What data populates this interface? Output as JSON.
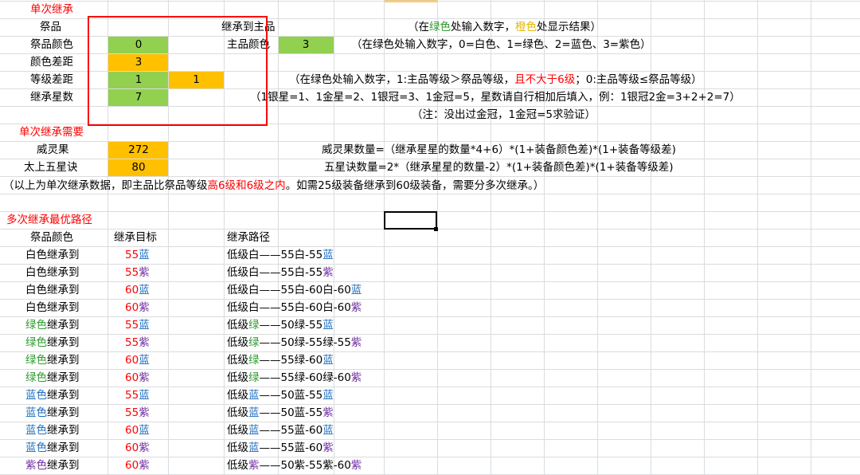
{
  "colors": {
    "green_cell": "#92d050",
    "orange_cell": "#ffc000",
    "red_text": "#ff0000",
    "blue_text": "#1f6fbf",
    "purple_text": "#7030a0",
    "green_text": "#2e9b2e",
    "yellow_text": "#e6b800",
    "grid": "#dadcdd"
  },
  "single": {
    "title": "单次继承",
    "sacrifice": "祭品",
    "inherit_to": "继承到主品",
    "note1": {
      "a": "（在",
      "b": "绿色",
      "c": "处输入数字，",
      "d": "橙色",
      "e": "处显示结果）"
    },
    "sac_color_label": "祭品颜色",
    "sac_color_value": "0",
    "main_color_label": "主品颜色",
    "main_color_value": "3",
    "note2": "（在绿色处输入数字，0=白色、1=绿色、2=蓝色、3=紫色）",
    "color_diff_label": "颜色差距",
    "color_diff_value": "3",
    "level_diff_label": "等级差距",
    "level_diff_value": "1",
    "level_diff_result": "1",
    "note3": {
      "a": "（在绿色处输入数字，1:主品等级＞祭品等级，",
      "b": "且不大于6级",
      "c": "；0:主品等级≤祭品等级）"
    },
    "stars_label": "继承星数",
    "stars_value": "7",
    "note4": "（1银星=1、1金星=2、1银冠=3、1金冠=5，星数请自行相加后填入，例：1银冠2金=3+2+2=7）",
    "note5": "（注：没出过金冠，1金冠=5求验证）"
  },
  "need": {
    "title": "单次继承需要",
    "fruit_label": "威灵果",
    "fruit_value": "272",
    "fruit_formula": "威灵果数量=（继承星星的数量*4+6）*(1+装备颜色差)*(1+装备等级差)",
    "tactic_label": "太上五星诀",
    "tactic_value": "80",
    "tactic_formula": "五星诀数量=2*（继承星星的数量-2）*(1+装备颜色差)*(1+装备等级差)",
    "summary": {
      "a": "（以上为单次继承数据，即主品比祭品等级",
      "b": "高6级和6级之内",
      "c": "。如需25级装备继承到60级装备，需要分多次继承。）"
    }
  },
  "multi": {
    "title": "多次继承最优路径",
    "col_color": "祭品颜色",
    "col_target": "继承目标",
    "col_path": "继承路径",
    "rows": [
      {
        "src": [
          [
            "白色",
            "k"
          ],
          [
            "继承到",
            "k"
          ]
        ],
        "tgt": [
          [
            "55",
            "r"
          ],
          [
            "蓝",
            "b"
          ]
        ],
        "path": [
          [
            "低级白——55白-55",
            "k"
          ],
          [
            "蓝",
            "b"
          ]
        ]
      },
      {
        "src": [
          [
            "白色",
            "k"
          ],
          [
            "继承到",
            "k"
          ]
        ],
        "tgt": [
          [
            "55",
            "r"
          ],
          [
            "紫",
            "p"
          ]
        ],
        "path": [
          [
            "低级白——55白-55",
            "k"
          ],
          [
            "紫",
            "p"
          ]
        ]
      },
      {
        "src": [
          [
            "白色",
            "k"
          ],
          [
            "继承到",
            "k"
          ]
        ],
        "tgt": [
          [
            "60",
            "r"
          ],
          [
            "蓝",
            "b"
          ]
        ],
        "path": [
          [
            "低级白——55白-60白-60",
            "k"
          ],
          [
            "蓝",
            "b"
          ]
        ]
      },
      {
        "src": [
          [
            "白色",
            "k"
          ],
          [
            "继承到",
            "k"
          ]
        ],
        "tgt": [
          [
            "60",
            "r"
          ],
          [
            "紫",
            "p"
          ]
        ],
        "path": [
          [
            "低级白——55白-60白-60",
            "k"
          ],
          [
            "紫",
            "p"
          ]
        ]
      },
      {
        "src": [
          [
            "绿色",
            "g"
          ],
          [
            "继承到",
            "k"
          ]
        ],
        "tgt": [
          [
            "55",
            "r"
          ],
          [
            "蓝",
            "b"
          ]
        ],
        "path": [
          [
            "低级",
            "k"
          ],
          [
            "绿",
            "g"
          ],
          [
            "——50绿-55",
            "k"
          ],
          [
            "蓝",
            "b"
          ]
        ]
      },
      {
        "src": [
          [
            "绿色",
            "g"
          ],
          [
            "继承到",
            "k"
          ]
        ],
        "tgt": [
          [
            "55",
            "r"
          ],
          [
            "紫",
            "p"
          ]
        ],
        "path": [
          [
            "低级",
            "k"
          ],
          [
            "绿",
            "g"
          ],
          [
            "——50绿-55绿-55",
            "k"
          ],
          [
            "紫",
            "p"
          ]
        ]
      },
      {
        "src": [
          [
            "绿色",
            "g"
          ],
          [
            "继承到",
            "k"
          ]
        ],
        "tgt": [
          [
            "60",
            "r"
          ],
          [
            "蓝",
            "b"
          ]
        ],
        "path": [
          [
            "低级",
            "k"
          ],
          [
            "绿",
            "g"
          ],
          [
            "——55绿-60",
            "k"
          ],
          [
            "蓝",
            "b"
          ]
        ]
      },
      {
        "src": [
          [
            "绿色",
            "g"
          ],
          [
            "继承到",
            "k"
          ]
        ],
        "tgt": [
          [
            "60",
            "r"
          ],
          [
            "紫",
            "p"
          ]
        ],
        "path": [
          [
            "低级",
            "k"
          ],
          [
            "绿",
            "g"
          ],
          [
            "——55绿-60绿-60",
            "k"
          ],
          [
            "紫",
            "p"
          ]
        ]
      },
      {
        "src": [
          [
            "蓝色",
            "b"
          ],
          [
            "继承到",
            "k"
          ]
        ],
        "tgt": [
          [
            "55",
            "r"
          ],
          [
            "蓝",
            "b"
          ]
        ],
        "path": [
          [
            "低级",
            "k"
          ],
          [
            "蓝",
            "b"
          ],
          [
            "——50蓝-55",
            "k"
          ],
          [
            "蓝",
            "b"
          ]
        ]
      },
      {
        "src": [
          [
            "蓝色",
            "b"
          ],
          [
            "继承到",
            "k"
          ]
        ],
        "tgt": [
          [
            "55",
            "r"
          ],
          [
            "紫",
            "p"
          ]
        ],
        "path": [
          [
            "低级",
            "k"
          ],
          [
            "蓝",
            "b"
          ],
          [
            "——50蓝-55",
            "k"
          ],
          [
            "紫",
            "p"
          ]
        ]
      },
      {
        "src": [
          [
            "蓝色",
            "b"
          ],
          [
            "继承到",
            "k"
          ]
        ],
        "tgt": [
          [
            "60",
            "r"
          ],
          [
            "蓝",
            "b"
          ]
        ],
        "path": [
          [
            "低级",
            "k"
          ],
          [
            "蓝",
            "b"
          ],
          [
            "——55蓝-60",
            "k"
          ],
          [
            "蓝",
            "b"
          ]
        ]
      },
      {
        "src": [
          [
            "蓝色",
            "b"
          ],
          [
            "继承到",
            "k"
          ]
        ],
        "tgt": [
          [
            "60",
            "r"
          ],
          [
            "紫",
            "p"
          ]
        ],
        "path": [
          [
            "低级",
            "k"
          ],
          [
            "蓝",
            "b"
          ],
          [
            "——55蓝-60",
            "k"
          ],
          [
            "紫",
            "p"
          ]
        ]
      },
      {
        "src": [
          [
            "紫色",
            "p"
          ],
          [
            "继承到",
            "k"
          ]
        ],
        "tgt": [
          [
            "60",
            "r"
          ],
          [
            "紫",
            "p"
          ]
        ],
        "path": [
          [
            "低级",
            "k"
          ],
          [
            "紫",
            "p"
          ],
          [
            "——50紫-55紫-60",
            "k"
          ],
          [
            "紫",
            "p"
          ]
        ]
      }
    ]
  }
}
